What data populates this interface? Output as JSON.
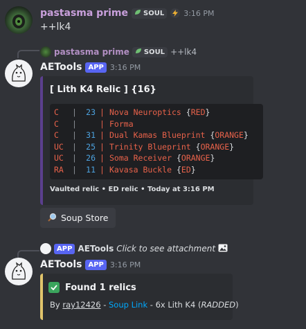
{
  "message1": {
    "username": "pastasma prime",
    "tag": "SOUL",
    "time": "3:16 PM",
    "text": "++lk4"
  },
  "reply1": {
    "username": "pastasma prime",
    "tag": "SOUL",
    "text": "++lk4"
  },
  "message2": {
    "username": "AETools",
    "badge": "APP",
    "time": "3:16 PM",
    "embed": {
      "title": "[ Lith K4 Relic ] {16}",
      "rows": [
        {
          "tier": "C",
          "num": "23",
          "name": "Nova Neuroptics",
          "status": "RED"
        },
        {
          "tier": "C",
          "num": "",
          "name": "Forma",
          "status": ""
        },
        {
          "tier": "C",
          "num": "31",
          "name": "Dual Kamas Blueprint",
          "status": "ORANGE"
        },
        {
          "tier": "UC",
          "num": "25",
          "name": "Trinity Blueprint",
          "status": "ORANGE"
        },
        {
          "tier": "UC",
          "num": "26",
          "name": "Soma Receiver",
          "status": "ORANGE"
        },
        {
          "tier": "RA",
          "num": "11",
          "name": "Kavasa Buckle",
          "status": "ED"
        }
      ],
      "footer": "Vaulted relic • ED relic • Today at 3:16 PM"
    },
    "button_label": "Soup Store",
    "button_icon": "magnifier-icon"
  },
  "reply2": {
    "badge": "APP",
    "username": "AETools",
    "text": "Click to see attachment"
  },
  "message3": {
    "username": "AETools",
    "badge": "APP",
    "time": "3:16 PM",
    "embed": {
      "title": "Found 1 relics",
      "by": "By",
      "user": "ray12426",
      "sep1": "-",
      "link": "Soup Link",
      "sep2": "- 6x Lith K4 (",
      "status": "RADDED",
      "close": ")"
    }
  },
  "colors": {
    "background": "#313338",
    "embed_accent_1": "#5b3f8e",
    "embed_accent_2": "#e0c46b",
    "app_badge": "#5865f2",
    "link": "#00a8fc"
  }
}
